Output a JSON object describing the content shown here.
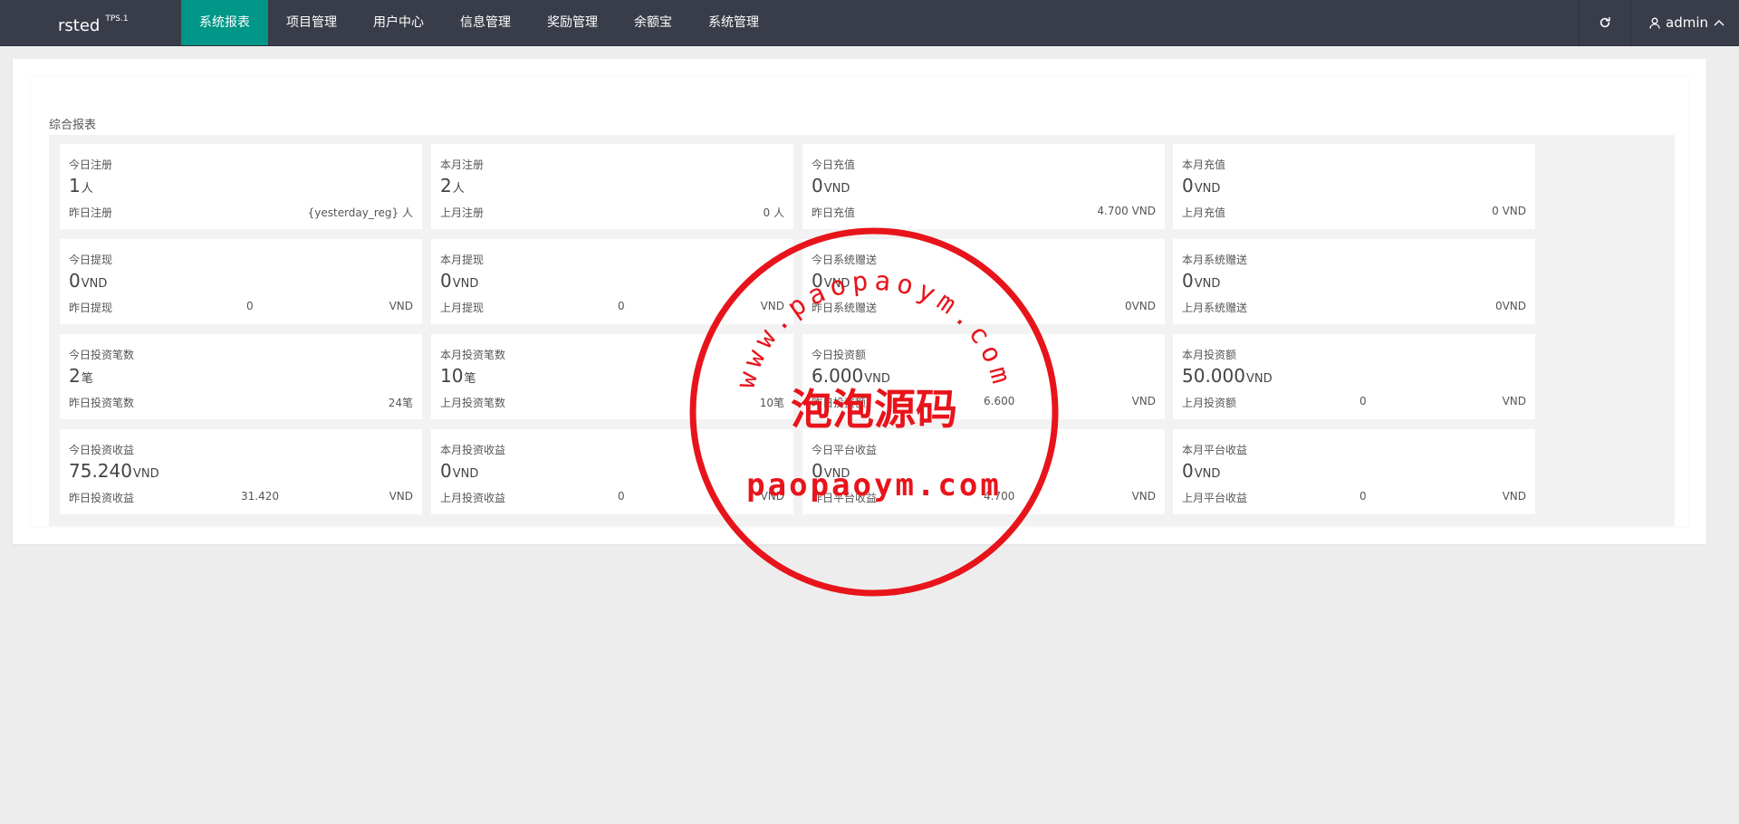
{
  "app": {
    "logo": "rsted",
    "version": "TPS.1"
  },
  "nav": {
    "items": [
      {
        "label": "系统报表",
        "active": true
      },
      {
        "label": "项目管理"
      },
      {
        "label": "用户中心"
      },
      {
        "label": "信息管理"
      },
      {
        "label": "奖励管理"
      },
      {
        "label": "余额宝"
      },
      {
        "label": "系统管理"
      }
    ],
    "user": "admin"
  },
  "panel": {
    "title": "综合报表"
  },
  "cards": [
    {
      "label": "今日注册",
      "value": "1",
      "unit": "人",
      "sub_label": "昨日注册",
      "sub_mid": "",
      "sub_right": "{yesterday_reg} 人"
    },
    {
      "label": "本月注册",
      "value": "2",
      "unit": "人",
      "sub_label": "上月注册",
      "sub_mid": "",
      "sub_right": "0 人"
    },
    {
      "label": "今日充值",
      "value": "0",
      "unit": "VND",
      "sub_label": "昨日充值",
      "sub_mid": "",
      "sub_right": "4.700 VND"
    },
    {
      "label": "本月充值",
      "value": "0",
      "unit": "VND",
      "sub_label": "上月充值",
      "sub_mid": "",
      "sub_right": "0 VND"
    },
    {
      "label": "今日提现",
      "value": "0",
      "unit": "VND",
      "sub_label": "昨日提现",
      "sub_mid": "0",
      "sub_right": "VND"
    },
    {
      "label": "本月提现",
      "value": "0",
      "unit": "VND",
      "sub_label": "上月提现",
      "sub_mid": "0",
      "sub_right": "VND"
    },
    {
      "label": "今日系统赠送",
      "value": "0",
      "unit": "VND",
      "sub_label": "昨日系统赠送",
      "sub_mid": "",
      "sub_right": "0VND"
    },
    {
      "label": "本月系统赠送",
      "value": "0",
      "unit": "VND",
      "sub_label": "上月系统赠送",
      "sub_mid": "",
      "sub_right": "0VND"
    },
    {
      "label": "今日投资笔数",
      "value": "2",
      "unit": "笔",
      "sub_label": "昨日投资笔数",
      "sub_mid": "",
      "sub_right": "24笔"
    },
    {
      "label": "本月投资笔数",
      "value": "10",
      "unit": "笔",
      "sub_label": "上月投资笔数",
      "sub_mid": "",
      "sub_right": "10笔"
    },
    {
      "label": "今日投资额",
      "value": "6.000",
      "unit": "VND",
      "sub_label": "昨日投资额",
      "sub_mid": "6.600",
      "sub_right": "VND"
    },
    {
      "label": "本月投资额",
      "value": "50.000",
      "unit": "VND",
      "sub_label": "上月投资额",
      "sub_mid": "0",
      "sub_right": "VND"
    },
    {
      "label": "今日投资收益",
      "value": "75.240",
      "unit": "VND",
      "sub_label": "昨日投资收益",
      "sub_mid": "31.420",
      "sub_right": "VND"
    },
    {
      "label": "本月投资收益",
      "value": "0",
      "unit": "VND",
      "sub_label": "上月投资收益",
      "sub_mid": "0",
      "sub_right": "VND"
    },
    {
      "label": "今日平台收益",
      "value": "0",
      "unit": "VND",
      "sub_label": "昨日平台收益",
      "sub_mid": "4.700",
      "sub_right": "VND"
    },
    {
      "label": "本月平台收益",
      "value": "0",
      "unit": "VND",
      "sub_label": "上月平台收益",
      "sub_mid": "0",
      "sub_right": "VND"
    }
  ],
  "watermark": {
    "arc_text": "www.paopaoym.com",
    "center_text": "泡泡源码",
    "bottom_text": "paopaoym.com",
    "color": "#e8141b"
  },
  "colors": {
    "nav_bg": "#393d49",
    "active": "#009688"
  }
}
